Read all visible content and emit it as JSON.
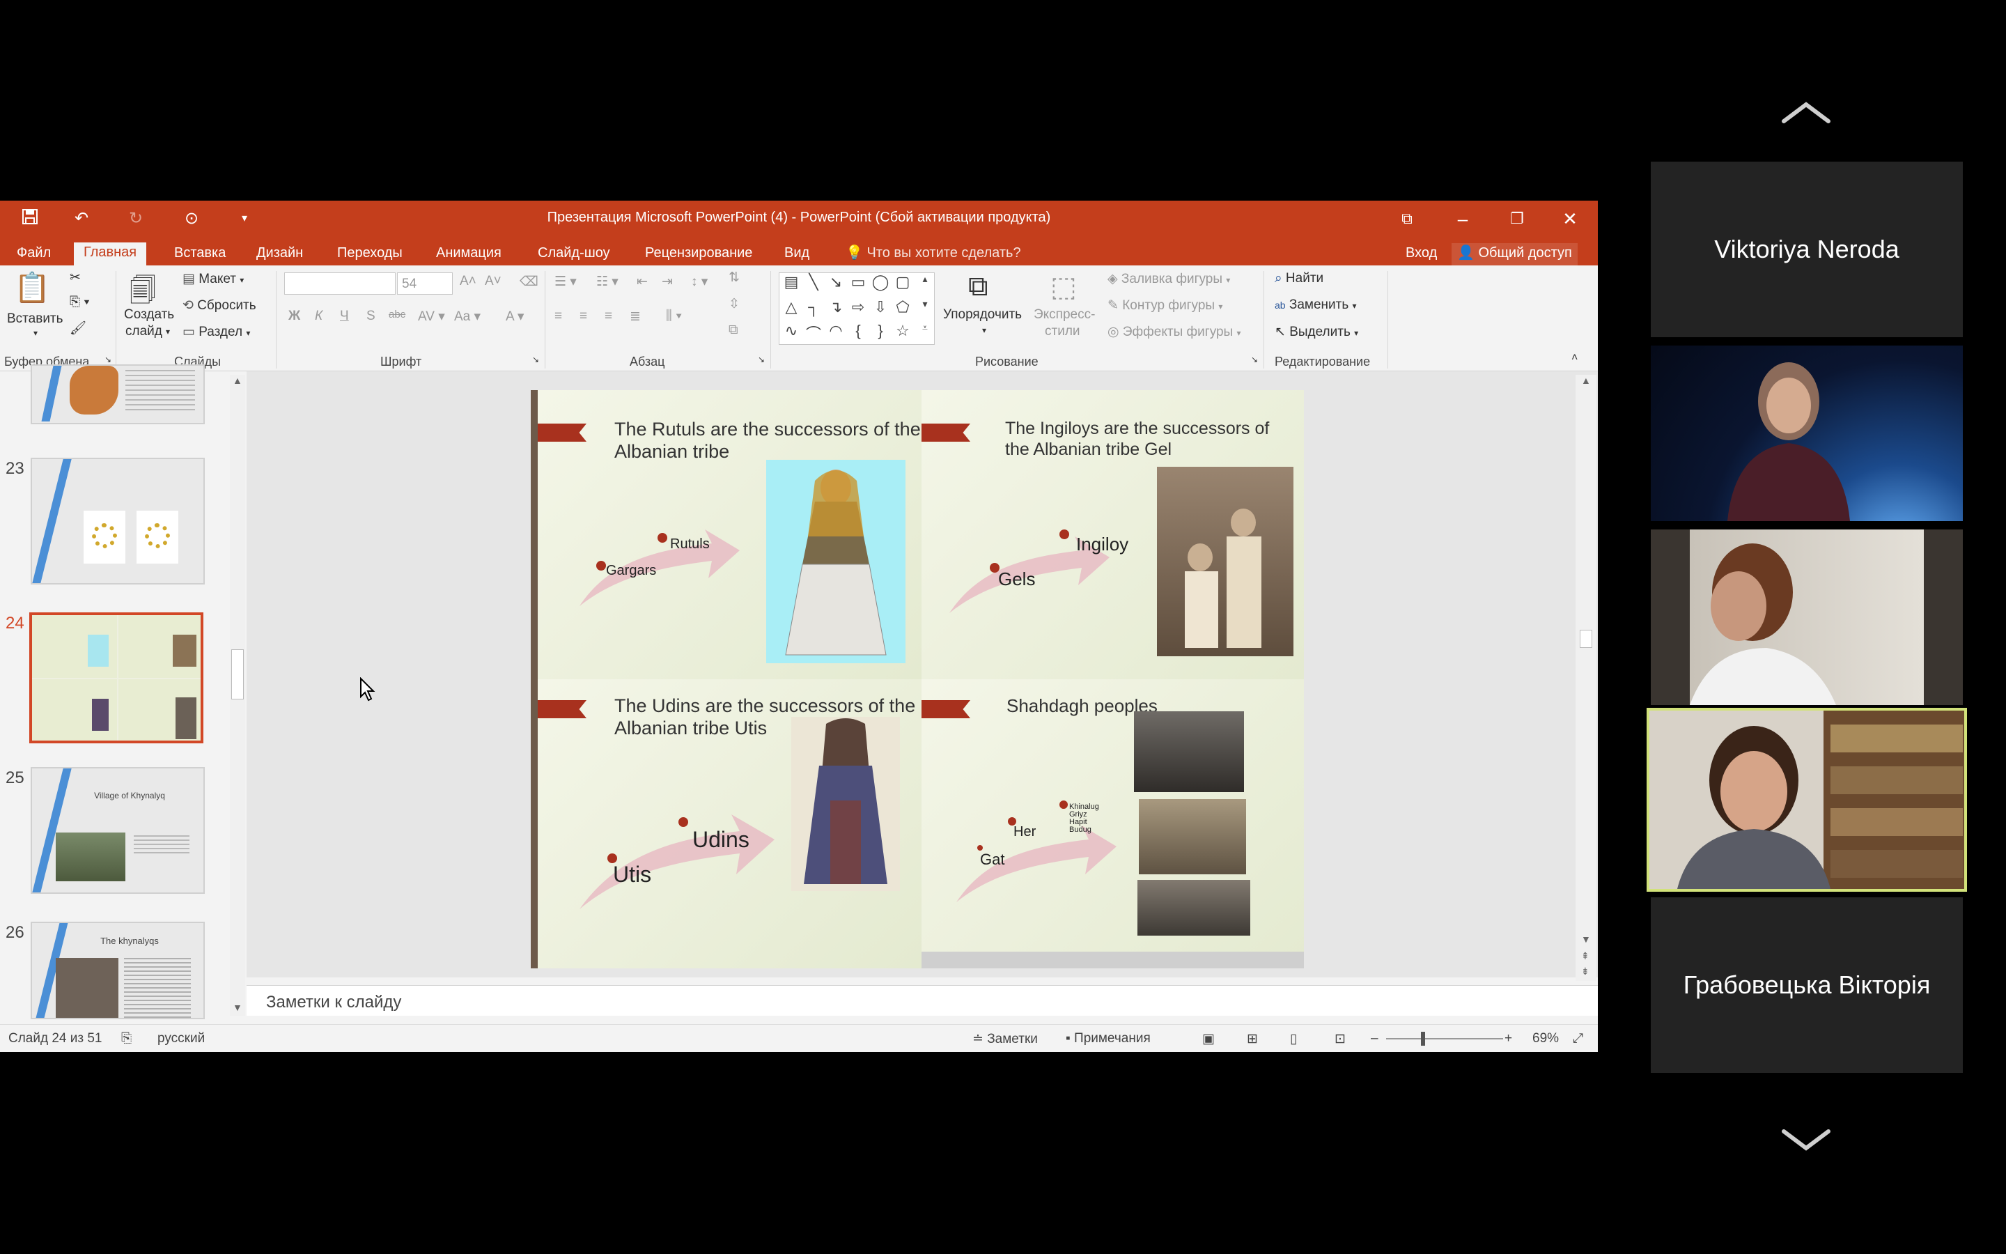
{
  "window": {
    "title": "Презентация Microsoft PowerPoint (4) - PowerPoint (Сбой активации продукта)"
  },
  "tabs": [
    {
      "label": "Файл"
    },
    {
      "label": "Главная"
    },
    {
      "label": "Вставка"
    },
    {
      "label": "Дизайн"
    },
    {
      "label": "Переходы"
    },
    {
      "label": "Анимация"
    },
    {
      "label": "Слайд-шоу"
    },
    {
      "label": "Рецензирование"
    },
    {
      "label": "Вид"
    }
  ],
  "tell_me": "Что вы хотите сделать?",
  "signin": "Вход",
  "share": "Общий доступ",
  "ribbon": {
    "paste": "Вставить",
    "new_slide_1": "Создать",
    "new_slide_2": "слайд",
    "layout": "Макет",
    "reset": "Сбросить",
    "section": "Раздел",
    "font_size": "54",
    "arrange": "Упорядочить",
    "quick_styles_1": "Экспресс-",
    "quick_styles_2": "стили",
    "shape_fill": "Заливка фигуры",
    "shape_outline": "Контур фигуры",
    "shape_effects": "Эффекты фигуры",
    "find": "Найти",
    "replace": "Заменить",
    "select": "Выделить",
    "groups": {
      "clipboard": "Буфер обмена",
      "slides": "Слайды",
      "font": "Шрифт",
      "paragraph": "Абзац",
      "drawing": "Рисование",
      "editing": "Редактирование"
    }
  },
  "thumbnails": [
    {
      "num": "23"
    },
    {
      "num": "24"
    },
    {
      "num": "25",
      "title": "Village of Khynalyq"
    },
    {
      "num": "26",
      "title": "The khynalyqs"
    }
  ],
  "slide": {
    "q1": {
      "title": "The Rutuls are the successors of the Albanian tribe",
      "label_a": "Gargars",
      "label_b": "Rutuls"
    },
    "q2": {
      "title": "The Ingiloys are the successors of the Albanian tribe Gel",
      "label_a": "Gels",
      "label_b": "Ingiloy"
    },
    "q3": {
      "title": "The Udins are the successors of the Albanian tribe Utis",
      "label_a": "Utis",
      "label_b": "Udins"
    },
    "q4": {
      "title": "Shahdagh peoples",
      "label_a": "Gat",
      "label_b": "Her",
      "label_c1": "Khinalug",
      "label_c2": "Griyz",
      "label_c3": "Hapit",
      "label_c4": "Budug"
    }
  },
  "notes_placeholder": "Заметки к слайду",
  "status": {
    "slide_info": "Слайд 24 из 51",
    "language": "русский",
    "notes": "Заметки",
    "comments": "Примечания",
    "zoom": "69%"
  },
  "participants": [
    {
      "name": "Viktoriya Neroda"
    },
    {
      "name": "Грабовецька Вікторія"
    }
  ]
}
